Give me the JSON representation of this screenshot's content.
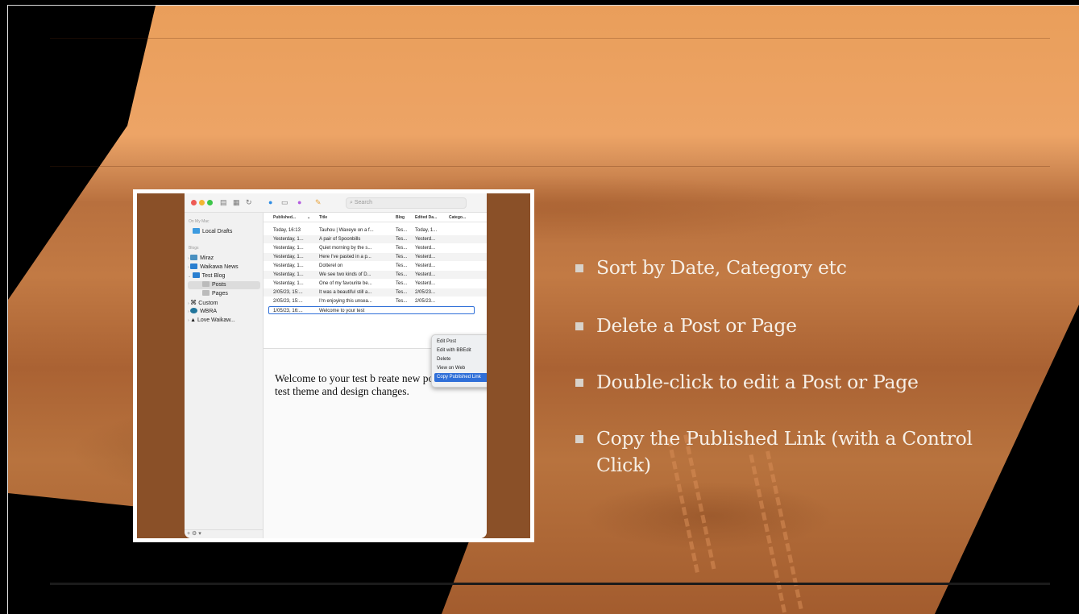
{
  "app": {
    "search_placeholder": "Search",
    "sidebar": {
      "section_on_my_mac": "On My Mac",
      "local_drafts": "Local Drafts",
      "section_blogs": "Blogs",
      "blogs": [
        "Miraz",
        "Waikawa News",
        "Test Blog"
      ],
      "sub_posts": "Posts",
      "sub_pages": "Pages",
      "others": [
        "Custom",
        "WBRA",
        "Love Waikaw..."
      ],
      "bottom_controls": "+  ⚙ ▾"
    },
    "columns": [
      "Published...",
      "Title",
      "Blog",
      "Edited Da...",
      "Catego..."
    ],
    "rows": [
      {
        "published": "Today, 16:13",
        "title": "Tauhou | Waxeye on a f...",
        "blog": "Tes...",
        "edited": "Today, 1..."
      },
      {
        "published": "Yesterday, 1...",
        "title": "A pair of Spoonbills",
        "blog": "Tes...",
        "edited": "Yesterd..."
      },
      {
        "published": "Yesterday, 1...",
        "title": "Quiet morning by the s...",
        "blog": "Tes...",
        "edited": "Yesterd..."
      },
      {
        "published": "Yesterday, 1...",
        "title": "Here I've pasted in a p...",
        "blog": "Tes...",
        "edited": "Yesterd..."
      },
      {
        "published": "Yesterday, 1...",
        "title": "Dotterel on",
        "blog": "Tes...",
        "edited": "Yesterd..."
      },
      {
        "published": "Yesterday, 1...",
        "title": "We see two kinds of D...",
        "blog": "Tes...",
        "edited": "Yesterd..."
      },
      {
        "published": "Yesterday, 1...",
        "title": "One of my favourite be...",
        "blog": "Tes...",
        "edited": "Yesterd..."
      },
      {
        "published": "2/05/23, 15:...",
        "title": "It was a beautiful still a...",
        "blog": "Tes...",
        "edited": "2/05/23..."
      },
      {
        "published": "2/05/23, 15:...",
        "title": "I'm enjoying this unsea...",
        "blog": "Tes...",
        "edited": "2/05/23..."
      },
      {
        "published": "1/05/23, 16:...",
        "title": "Welcome to your test",
        "blog": "",
        "edited": ""
      }
    ],
    "preview_text": "Welcome to your test b        reate new posts here to test theme and design changes.",
    "context_menu": [
      "Edit Post",
      "Edit with BBEdit",
      "Delete",
      "View on Web",
      "Copy Published Link"
    ]
  },
  "bullets": [
    "Sort by Date, Category etc",
    "Delete a Post or Page",
    "Double-click to edit a Post or Page",
    "Copy the Published Link (with a Control Click)"
  ]
}
